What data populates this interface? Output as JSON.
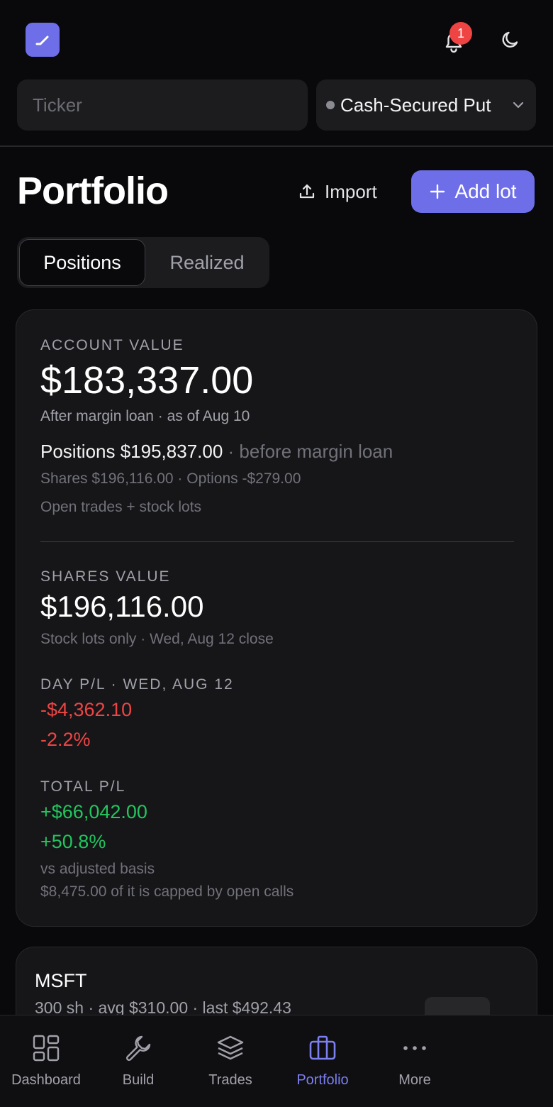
{
  "header": {
    "logo_icon": "trend-line-icon",
    "notifications": {
      "icon": "bell-icon",
      "badge_count": "1"
    },
    "theme_toggle_icon": "moon-icon"
  },
  "search": {
    "ticker_placeholder": "Ticker",
    "ticker_value": "",
    "strategy_selected": "Cash-Secured Put"
  },
  "page": {
    "title": "Portfolio",
    "import_label": "Import",
    "add_lot_label": "Add lot"
  },
  "tabs": [
    {
      "label": "Positions",
      "active": true
    },
    {
      "label": "Realized",
      "active": false
    }
  ],
  "summary": {
    "account_value_label": "ACCOUNT VALUE",
    "account_value": "$183,337.00",
    "account_value_note": "After margin loan · as of Aug 10",
    "positions_text": "Positions $195,837.00",
    "positions_note": "· before margin loan",
    "breakdown": "Shares $196,116.00 · Options -$279.00",
    "breakdown_note": "Open trades + stock lots",
    "shares_value_label": "SHARES VALUE",
    "shares_value": "$196,116.00",
    "shares_value_note": "Stock lots only · Wed, Aug 12 close",
    "day_pl_label": "DAY P/L · WED, AUG 12",
    "day_pl_amount": "-$4,362.10",
    "day_pl_percent": "-2.2%",
    "total_pl_label": "TOTAL P/L",
    "total_pl_amount": "+$66,042.00",
    "total_pl_percent": "+50.8%",
    "total_pl_note1": "vs adjusted basis",
    "total_pl_note2": "$8,475.00 of it is capped by open calls"
  },
  "positions": [
    {
      "ticker": "MSFT",
      "detail": "300 sh · avg $310.00 · last $492.43"
    }
  ],
  "nav": [
    {
      "label": "Dashboard",
      "icon": "grid-icon",
      "active": false
    },
    {
      "label": "Build",
      "icon": "wrench-icon",
      "active": false
    },
    {
      "label": "Trades",
      "icon": "layers-icon",
      "active": false
    },
    {
      "label": "Portfolio",
      "icon": "briefcase-icon",
      "active": true
    },
    {
      "label": "More",
      "icon": "more-dots-icon",
      "active": false
    }
  ],
  "colors": {
    "accent": "#6d6ee8",
    "negative": "#ef4444",
    "positive": "#22c55e",
    "background": "#09090b"
  }
}
